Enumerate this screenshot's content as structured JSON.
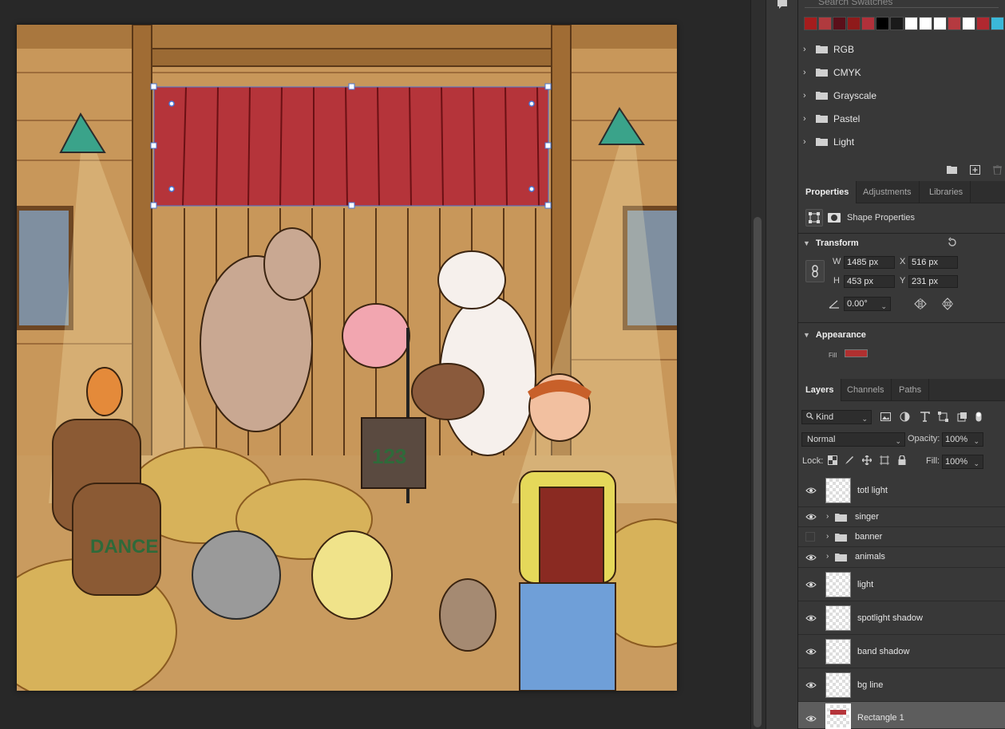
{
  "swatches": {
    "search_placeholder": "Search Swatches",
    "recent_colors": [
      "#a51d1d",
      "#b03a3e",
      "#5a0f1a",
      "#8f1a1a",
      "#b0303a",
      "#000000",
      "#1a1a1a",
      "#ffffff",
      "#ffffff",
      "#ffffff",
      "#b53a40",
      "#ffffff",
      "#b02830",
      "#3bb8d8"
    ],
    "folders": [
      "RGB",
      "CMYK",
      "Grayscale",
      "Pastel",
      "Light"
    ]
  },
  "properties_tabs": [
    "Properties",
    "Adjustments",
    "Libraries"
  ],
  "properties": {
    "shape_label": "Shape Properties",
    "transform_label": "Transform",
    "w_label": "W",
    "w_value": "1485 px",
    "h_label": "H",
    "h_value": "453 px",
    "x_label": "X",
    "x_value": "516 px",
    "y_label": "Y",
    "y_value": "231 px",
    "angle_value": "0.00°",
    "appearance_label": "Appearance",
    "fill_label": "Fill",
    "fill_color": "#b03030"
  },
  "layers_tabs": [
    "Layers",
    "Channels",
    "Paths"
  ],
  "layers_panel": {
    "kind_label": "Kind",
    "blend_mode": "Normal",
    "opacity_label": "Opacity:",
    "opacity_value": "100%",
    "lock_label": "Lock:",
    "fill_label": "Fill:",
    "fill_value": "100%"
  },
  "layers": [
    {
      "name": "totl light",
      "type": "pixel",
      "visible": true
    },
    {
      "name": "singer",
      "type": "group",
      "visible": true
    },
    {
      "name": "banner",
      "type": "group",
      "visible": false
    },
    {
      "name": "animals",
      "type": "group",
      "visible": true
    },
    {
      "name": "light",
      "type": "pixel",
      "visible": true
    },
    {
      "name": "spotlight shadow",
      "type": "pixel",
      "visible": true
    },
    {
      "name": "band shadow",
      "type": "pixel",
      "visible": true
    },
    {
      "name": "bg line",
      "type": "pixel",
      "visible": true
    },
    {
      "name": "Rectangle 1",
      "type": "shape",
      "visible": true,
      "selected": true
    }
  ],
  "artwork": {
    "crate_text": "123",
    "barrel_text": "DANCE",
    "banner_color": "#b5343a"
  }
}
